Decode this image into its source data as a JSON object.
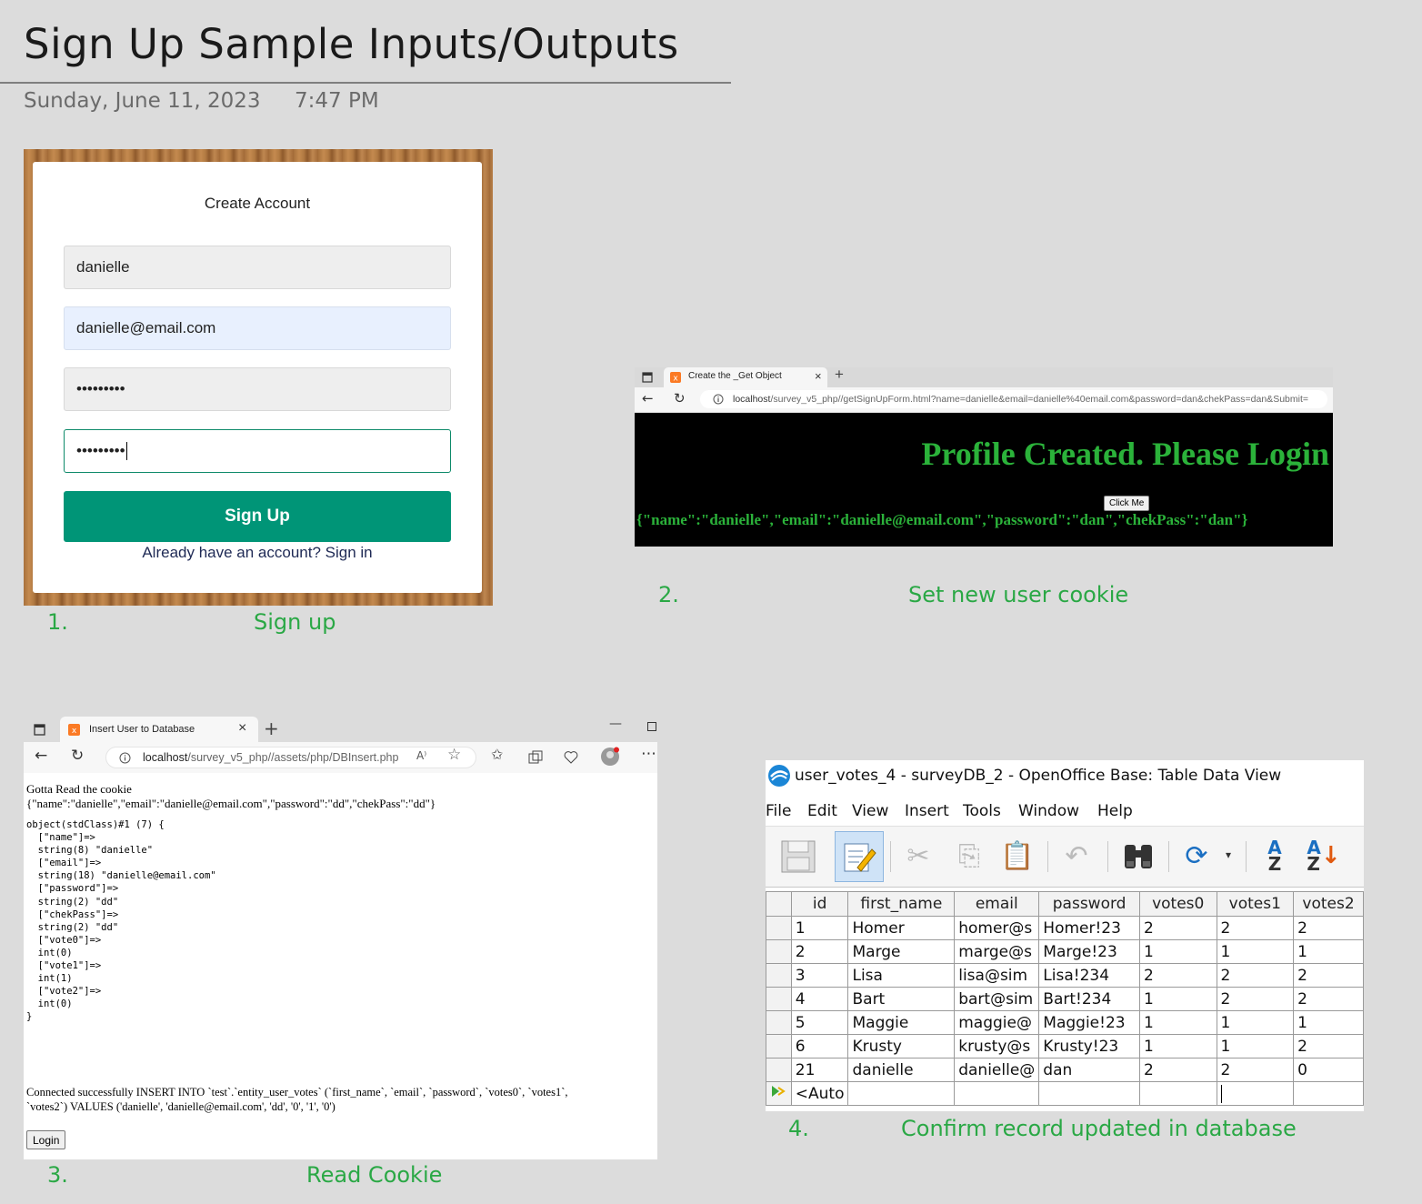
{
  "page": {
    "title": "Sign Up Sample Inputs/Outputs",
    "date": "Sunday, June 11, 2023",
    "time": "7:47 PM"
  },
  "captions": {
    "c1_num": "1.",
    "c1_text": "Sign up",
    "c2_num": "2.",
    "c2_text": "Set new user cookie",
    "c3_num": "3.",
    "c3_text": "Read Cookie",
    "c4_num": "4.",
    "c4_text": "Confirm record updated in database"
  },
  "signup": {
    "title": "Create Account",
    "name_value": "danielle",
    "email_value": "danielle@email.com",
    "password_mask": "•••••••••",
    "confirm_mask": "•••••••••",
    "button": "Sign Up",
    "signin_link": "Already have an account? Sign in"
  },
  "browser2": {
    "tab_title": "Create the _Get Object",
    "url_host": "localhost",
    "url_path": "/survey_v5_php//getSignUpForm.html?name=danielle&email=danielle%40email.com&password=dan&chekPass=dan&Submit=",
    "heading": "Profile Created. Please Login",
    "button": "Click Me",
    "json": "{\"name\":\"danielle\",\"email\":\"danielle@email.com\",\"password\":\"dan\",\"chekPass\":\"dan\"}"
  },
  "browser3": {
    "tab_title": "Insert User to Database",
    "url_host": "localhost",
    "url_path": "/survey_v5_php//assets/php/DBInsert.php",
    "line1": "Gotta Read the cookie",
    "line2": "{\"name\":\"danielle\",\"email\":\"danielle@email.com\",\"password\":\"dd\",\"chekPass\":\"dd\"}",
    "dump": "object(stdClass)#1 (7) {\n  [\"name\"]=>\n  string(8) \"danielle\"\n  [\"email\"]=>\n  string(18) \"danielle@email.com\"\n  [\"password\"]=>\n  string(2) \"dd\"\n  [\"chekPass\"]=>\n  string(2) \"dd\"\n  [\"vote0\"]=>\n  int(0)\n  [\"vote1\"]=>\n  int(1)\n  [\"vote2\"]=>\n  int(0)\n}",
    "sql": "Connected successfully INSERT INTO `test`.`entity_user_votes` (`first_name`, `email`, `password`, `votes0`, `votes1`,\n`votes2`) VALUES ('danielle', 'danielle@email.com', 'dd', '0', '1', '0')",
    "login_button": "Login"
  },
  "oo": {
    "window_title": "user_votes_4 - surveyDB_2 - OpenOffice Base: Table Data View",
    "menu": [
      "File",
      "Edit",
      "View",
      "Insert",
      "Tools",
      "Window",
      "Help"
    ],
    "columns": [
      "id",
      "first_name",
      "email",
      "password",
      "votes0",
      "votes1",
      "votes2"
    ],
    "rows": [
      [
        "1",
        "Homer",
        "homer@s",
        "Homer!23",
        "2",
        "2",
        "2"
      ],
      [
        "2",
        "Marge",
        "marge@s",
        "Marge!23",
        "1",
        "1",
        "1"
      ],
      [
        "3",
        "Lisa",
        "lisa@sim",
        "Lisa!234",
        "2",
        "2",
        "2"
      ],
      [
        "4",
        "Bart",
        "bart@sim",
        "Bart!234",
        "1",
        "2",
        "2"
      ],
      [
        "5",
        "Maggie",
        "maggie@",
        "Maggie!23",
        "1",
        "1",
        "1"
      ],
      [
        "6",
        "Krusty",
        "krusty@s",
        "Krusty!23",
        "1",
        "1",
        "2"
      ],
      [
        "21",
        "danielle",
        "danielle@",
        "dan",
        "2",
        "2",
        "0"
      ]
    ],
    "new_row": "<Auto"
  },
  "icons": {
    "brand_accent": "#009577",
    "caption_color": "#2aa845",
    "heading_green": "#2bb23a"
  }
}
